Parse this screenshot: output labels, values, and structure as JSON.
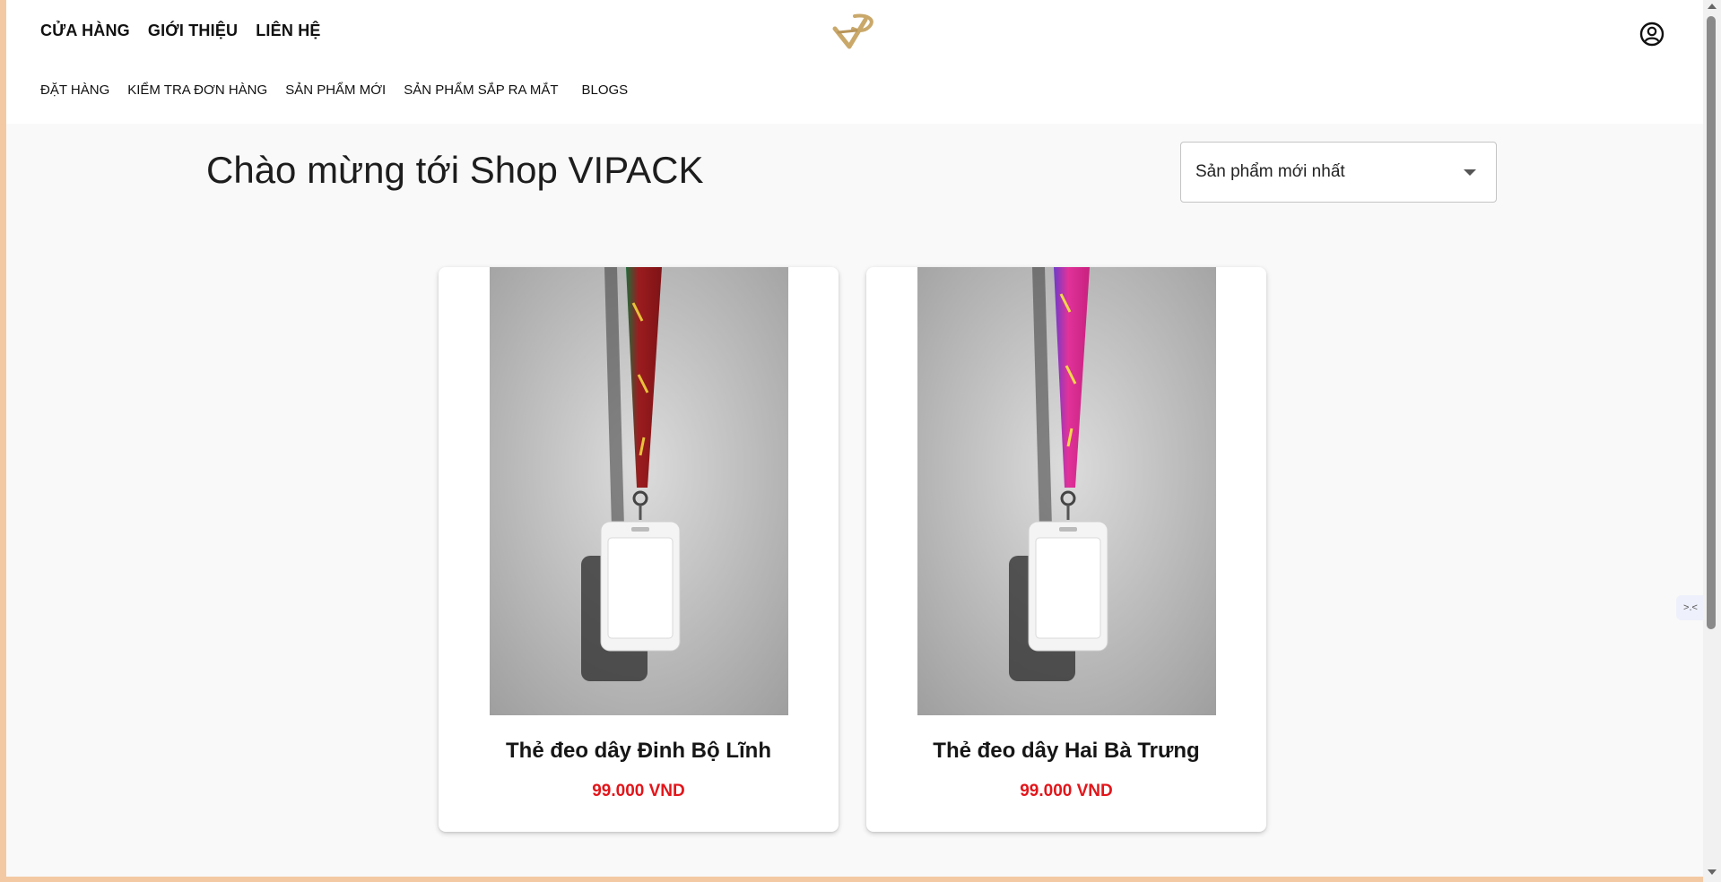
{
  "header": {
    "main_nav": [
      "CỬA HÀNG",
      "GIỚI THIỆU",
      "LIÊN HỆ"
    ],
    "sub_nav": [
      "ĐẶT HÀNG",
      "KIỂM TRA ĐƠN HÀNG",
      "SẢN PHẨM MỚI",
      "SẢN PHẨM SẮP RA MẮT",
      "BLOGS"
    ],
    "logo_icon": "vipack-logo-icon",
    "account_icon": "user-circle-icon"
  },
  "main": {
    "title": "Chào mừng tới Shop VIPACK",
    "sort_select": {
      "value": "Sản phẩm mới nhất",
      "icon": "caret-down-icon"
    }
  },
  "products": [
    {
      "name": "Thẻ đeo dây Đinh Bộ Lĩnh",
      "price": "99.000 VND",
      "image_icon": "lanyard-card-photo",
      "strap_color": "#9b1c1f",
      "strap_accent": "#1f6b3a"
    },
    {
      "name": "Thẻ đeo dây Hai Bà Trưng",
      "price": "99.000 VND",
      "image_icon": "lanyard-card-photo",
      "strap_color": "#e0329a",
      "strap_accent": "#6d3bc9"
    }
  ],
  "widgets": {
    "side_tab_icon": "chat-widget-icon",
    "side_tab_text": ">.<"
  },
  "colors": {
    "price": "#e3151a",
    "logo_gold": "#c9a86a",
    "page_bg": "#f9f9f9"
  }
}
